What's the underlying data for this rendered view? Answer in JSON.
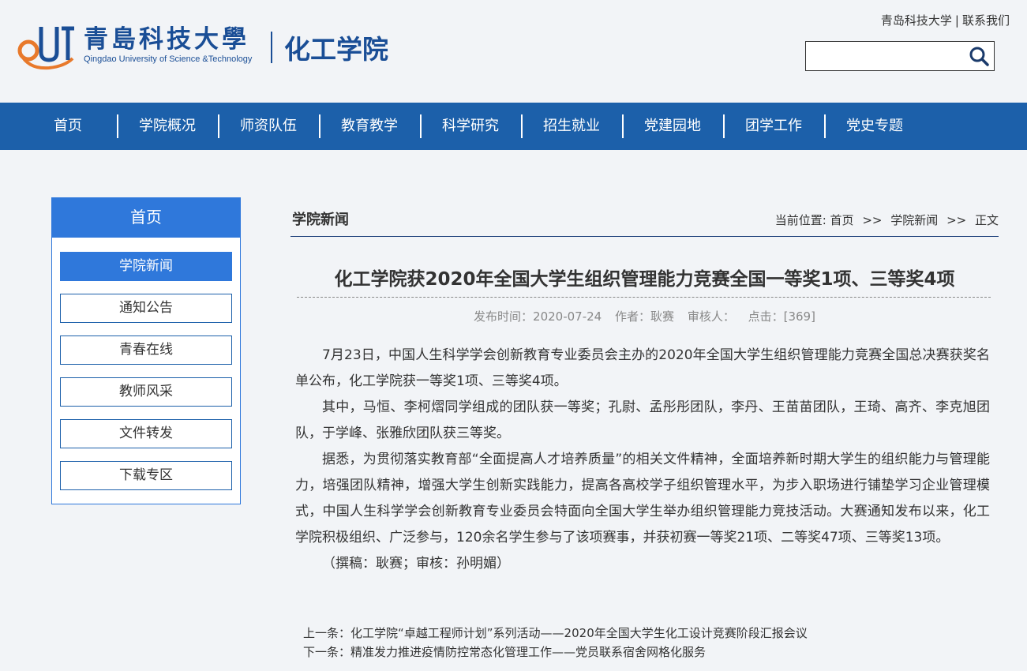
{
  "header": {
    "logo_cn": "青島科技大學",
    "logo_en": "Qingdao University of Science &Technology",
    "logo_mark_text": "QUST",
    "college_name": "化工学院",
    "top_links": [
      "青岛科技大学",
      "联系我们"
    ],
    "search": {
      "value": "",
      "placeholder": ""
    }
  },
  "nav": [
    "首页",
    "学院概况",
    "师资队伍",
    "教育教学",
    "科学研究",
    "招生就业",
    "党建园地",
    "团学工作",
    "党史专题"
  ],
  "sidebar": {
    "title": "首页",
    "items": [
      "学院新闻",
      "通知公告",
      "青春在线",
      "教师风采",
      "文件转发",
      "下载专区"
    ],
    "active_index": 0
  },
  "main": {
    "section_title": "学院新闻",
    "breadcrumb": {
      "prefix": "当前位置:",
      "items": [
        "首页",
        "学院新闻",
        "正文"
      ],
      "separator": ">>"
    },
    "article": {
      "title": "化工学院获2020年全国大学生组织管理能力竞赛全国一等奖1项、三等奖4项",
      "meta": {
        "publish": "发布时间：2020-07-24",
        "author": "作者：耿赛",
        "reviewer": "审核人：",
        "clicks": "点击：[369]"
      },
      "paragraphs": [
        "7月23日，中国人生科学学会创新教育专业委员会主办的2020年全国大学生组织管理能力竞赛全国总决赛获奖名单公布，化工学院获一等奖1项、三等奖4项。",
        "其中，马恒、李柯熠同学组成的团队获一等奖；孔尉、孟彤彤团队，李丹、王苗苗团队，王琦、高齐、李克旭团队，于学峰、张雅欣团队获三等奖。",
        "据悉，为贯彻落实教育部“全面提高人才培养质量”的相关文件精神，全面培养新时期大学生的组织能力与管理能力，培强团队精神，增强大学生创新实践能力，提高各高校学子组织管理水平，为步入职场进行铺垫学习企业管理模式，中国人生科学学会创新教育专业委员会特面向全国大学生举办组织管理能力竞技活动。大赛通知发布以来，化工学院积极组织、广泛参与，120余名学生参与了该项赛事，并获初赛一等奖21项、二等奖47项、三等奖13项。",
        "（撰稿：耿赛；审核：孙明媚）"
      ]
    },
    "prev": {
      "label": "上一条：",
      "title": "化工学院“卓越工程师计划”系列活动——2020年全国大学生化工设计竞赛阶段汇报会议"
    },
    "next": {
      "label": "下一条：",
      "title": "精准发力推进疫情防控常态化管理工作——党员联系宿舍网格化服务"
    }
  },
  "colors": {
    "nav_bg": "#1c60aa",
    "sidebar_accent": "#2f78db",
    "brand_blue": "#1a4e96",
    "logo_orange": "#e8792b",
    "page_bg": "#f2f4f7"
  }
}
